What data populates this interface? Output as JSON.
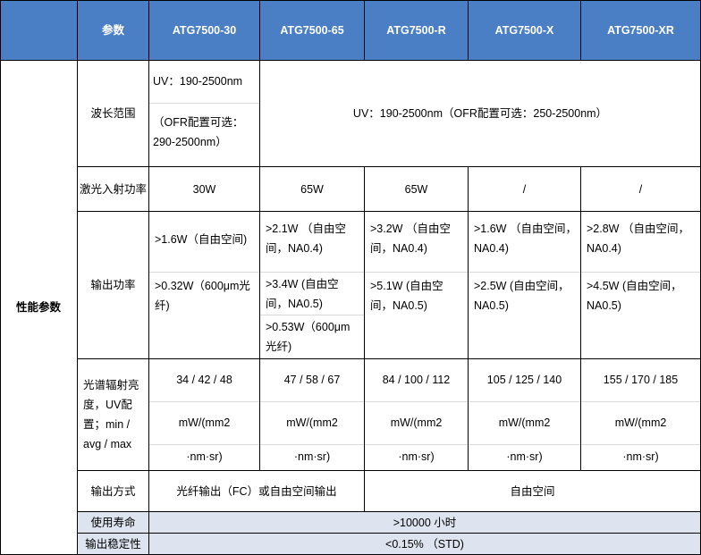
{
  "header": {
    "blank": "",
    "param": "参数",
    "models": [
      "ATG7500-30",
      "ATG7500-65",
      "ATG7500-R",
      "ATG7500-X",
      "ATG7500-XR"
    ]
  },
  "section_label": "性能参数",
  "rows": {
    "wavelength": {
      "label": "波长范围",
      "m30_line1": "UV：190-2500nm",
      "m30_line2": "（OFR配置可选：290-2500nm）",
      "others": "UV：190-2500nm（OFR配置可选：250-2500nm）"
    },
    "laser_power": {
      "label": "激光入射功率",
      "values": [
        "30W",
        "65W",
        "65W",
        "/",
        "/"
      ]
    },
    "output_power": {
      "label": "输出功率",
      "m30": [
        ">1.6W（自由空间)",
        ">0.32W（600μm光纤)"
      ],
      "m65": [
        ">2.1W （自由空间，NA0.4)",
        ">3.4W (自由空间，NA0.5)",
        ">0.53W（600μm光纤)"
      ],
      "mR": [
        ">3.2W （自由空间，NA0.4)",
        ">5.1W (自由空间，NA0.5)"
      ],
      "mX": [
        ">1.6W （自由空间，NA0.4)",
        ">2.5W (自由空间，NA0.5)"
      ],
      "mXR": [
        ">2.8W （自由空间，NA0.4)",
        ">4.5W (自由空间，NA0.5)"
      ]
    },
    "radiance": {
      "label": "光谱辐射亮度，UV配置；min / avg / max",
      "values": [
        "34 / 42 / 48",
        "47 / 58 / 67",
        "84 / 100 / 112",
        "105 / 125 / 140",
        "155 / 170 / 185"
      ],
      "unit1": "mW/(mm2",
      "unit2": "·nm·sr)"
    },
    "output_mode": {
      "label": "输出方式",
      "fiber": "光纤输出（FC）或自由空间输出",
      "free": "自由空间"
    },
    "lifetime": {
      "label": "使用寿命",
      "value": ">10000 小时"
    },
    "stability": {
      "label": "输出稳定性",
      "value": "<0.15%  （STD)"
    }
  }
}
